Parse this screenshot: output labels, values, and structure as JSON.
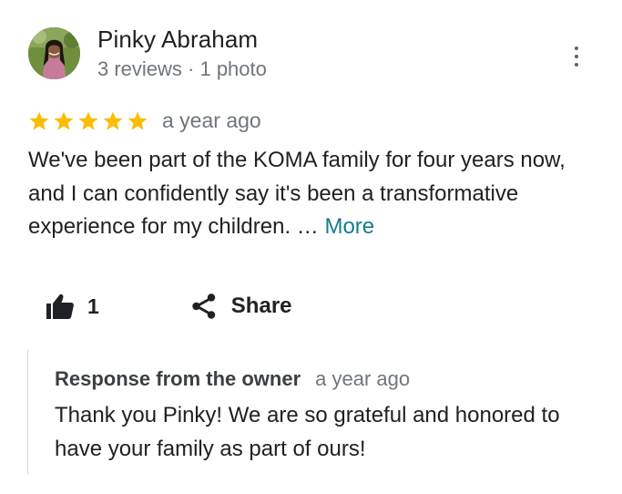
{
  "review": {
    "author": {
      "name": "Pinky Abraham",
      "meta": "3 reviews · 1 photo"
    },
    "rating": 5,
    "date": "a year ago",
    "text": "We've been part of the KOMA family for four years now, and I can confidently say it's been a transformative experience for my children. …",
    "more_label": "More",
    "likes": "1",
    "share_label": "Share",
    "star_color": "#fbbc04"
  },
  "owner_response": {
    "title": "Response from the owner",
    "date": "a year ago",
    "text": "Thank you Pinky! We are so grateful and honored to have your family as part of ours!"
  },
  "icons": {
    "more": "more-vert-icon",
    "like": "thumbs-up-icon",
    "share": "share-icon",
    "star": "star-icon"
  }
}
